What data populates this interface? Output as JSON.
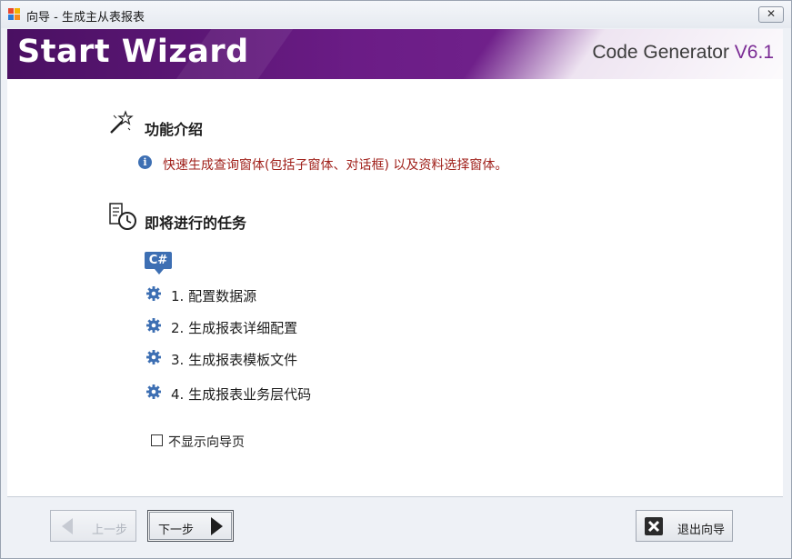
{
  "window": {
    "title": "向导 - 生成主从表报表",
    "close_label": "✕"
  },
  "banner": {
    "title": "Start Wizard",
    "product": "Code Generator",
    "version": "V6.1"
  },
  "intro": {
    "heading": "功能介绍",
    "info_glyph": "i",
    "text": "快速生成查询窗体(包括子窗体、对话框) 以及资料选择窗体。"
  },
  "tasks": {
    "heading": "即将进行的任务",
    "badge": "C#",
    "items": [
      {
        "label": "1. 配置数据源"
      },
      {
        "label": "2. 生成报表详细配置"
      },
      {
        "label": "3. 生成报表模板文件"
      },
      {
        "label": "4. 生成报表业务层代码"
      }
    ]
  },
  "options": {
    "dont_show_label": "不显示向导页",
    "dont_show_checked": false
  },
  "buttons": {
    "prev_label": "上一步",
    "next_label": "下一步",
    "exit_label": "退出向导"
  },
  "icons": {
    "app": "app-logo-icon",
    "intro": "magic-wand-icon",
    "tasks": "task-schedule-icon",
    "info": "info-icon",
    "task": "gear-icon",
    "prev": "arrow-left-icon",
    "next": "arrow-right-icon",
    "exit": "close-x-icon"
  },
  "colors": {
    "banner": "#5e1a7a",
    "accent_blue": "#3d6fb3",
    "intro_text": "#a0211b"
  }
}
